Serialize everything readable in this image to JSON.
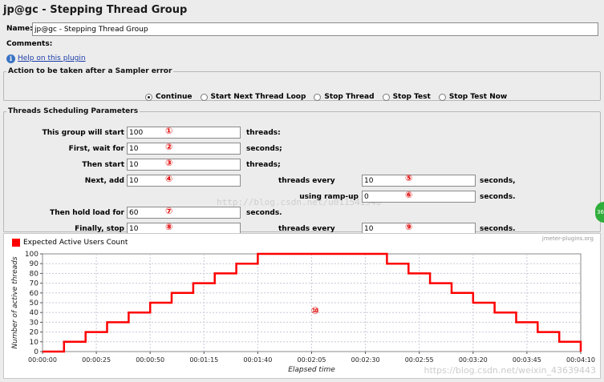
{
  "window": {
    "title": "jp@gc - Stepping Thread Group"
  },
  "name_field": {
    "label": "Name:",
    "value": "jp@gc - Stepping Thread Group"
  },
  "comments": {
    "label": "Comments:"
  },
  "help": {
    "link_text": "Help on this plugin"
  },
  "sampler_error": {
    "legend": "Action to be taken after a Sampler error",
    "options": [
      {
        "label": "Continue",
        "selected": true
      },
      {
        "label": "Start Next Thread Loop",
        "selected": false
      },
      {
        "label": "Stop Thread",
        "selected": false
      },
      {
        "label": "Stop Test",
        "selected": false
      },
      {
        "label": "Stop Test Now",
        "selected": false
      }
    ]
  },
  "scheduling": {
    "legend": "Threads Scheduling Parameters",
    "this_group_will_start": {
      "label": "This group will start",
      "value": "100",
      "unit": "threads:",
      "marker": "①"
    },
    "first_wait_for": {
      "label": "First, wait for",
      "value": "10",
      "unit": "seconds;",
      "marker": "②"
    },
    "then_start": {
      "label": "Then start",
      "value": "10",
      "unit": "threads;",
      "marker": "③"
    },
    "next_add": {
      "label": "Next, add",
      "value": "10",
      "marker": "④"
    },
    "next_add_every": {
      "label": "threads every",
      "value": "10",
      "unit": "seconds,",
      "marker": "⑤"
    },
    "ramp_up": {
      "label": "using ramp-up",
      "value": "0",
      "unit": "seconds.",
      "marker": "⑥"
    },
    "hold_load": {
      "label": "Then hold load for",
      "value": "60",
      "unit": "seconds.",
      "marker": "⑦"
    },
    "finally_stop": {
      "label": "Finally, stop",
      "value": "10",
      "marker": "⑧"
    },
    "stop_every": {
      "label": "threads every",
      "value": "10",
      "unit": "seconds.",
      "marker": "⑨"
    },
    "watermark": "http://blog.csdn.net/u011541946"
  },
  "chart_credit": "jmeter-plugins.org",
  "chart_marker": "⑩",
  "bottom_watermark": "https://blog.csdn.net/weixin_43639443",
  "side_tab_text": "36",
  "colors": {
    "series": "#ff0000",
    "link": "#1a3ca8",
    "marker": "#e00000"
  },
  "chart_data": {
    "type": "line",
    "legend": [
      "Expected Active Users Count"
    ],
    "xlabel": "Elapsed time",
    "ylabel": "Number of active threads",
    "ylim": [
      0,
      100
    ],
    "yticks": [
      0,
      10,
      20,
      30,
      40,
      50,
      60,
      70,
      80,
      90,
      100
    ],
    "xlim": [
      0,
      250
    ],
    "xtick_values": [
      0,
      25,
      50,
      75,
      100,
      125,
      150,
      175,
      200,
      225,
      250
    ],
    "xtick_labels": [
      "00:00:00",
      "00:00:25",
      "00:00:50",
      "00:01:15",
      "00:01:40",
      "00:02:05",
      "00:02:30",
      "00:02:55",
      "00:03:20",
      "00:03:45",
      "00:04:10"
    ],
    "grid": true,
    "series": [
      {
        "name": "Expected Active Users Count",
        "x": [
          0,
          10,
          10,
          20,
          20,
          30,
          30,
          40,
          40,
          50,
          50,
          60,
          60,
          70,
          70,
          80,
          80,
          90,
          90,
          100,
          100,
          160,
          160,
          170,
          170,
          180,
          180,
          190,
          190,
          200,
          200,
          210,
          210,
          220,
          220,
          230,
          230,
          240,
          240,
          250,
          250
        ],
        "y": [
          0,
          0,
          10,
          10,
          20,
          20,
          30,
          30,
          40,
          40,
          50,
          50,
          60,
          60,
          70,
          70,
          80,
          80,
          90,
          90,
          100,
          100,
          90,
          90,
          80,
          80,
          70,
          70,
          60,
          60,
          50,
          50,
          40,
          40,
          30,
          30,
          20,
          20,
          10,
          10,
          0
        ]
      }
    ]
  }
}
